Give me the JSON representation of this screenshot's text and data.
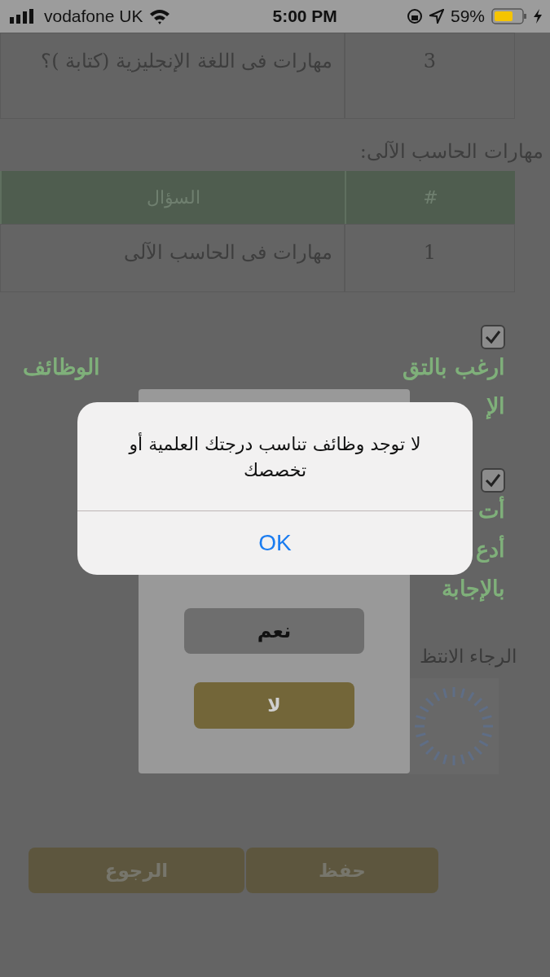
{
  "status_bar": {
    "carrier": "vodafone UK",
    "time": "5:00 PM",
    "battery": "59%"
  },
  "language_table": {
    "rows": [
      {
        "number": "3",
        "question": "مهارات فى اللغة الإنجليزية (كتابة )؟"
      }
    ]
  },
  "computer_section": {
    "heading": "مهارات الحاسب الآلى:",
    "columns": [
      "#",
      "السؤال"
    ],
    "rows": [
      {
        "number": "1",
        "question": "مهارات فى الحاسب الآلى"
      }
    ]
  },
  "agreements": [
    {
      "checked": true,
      "lines": [
        {
          "right": "ارغب بالتق",
          "left": "الوظائف"
        },
        {
          "right": "الإ"
        }
      ]
    },
    {
      "checked": true,
      "lines": [
        {
          "right": "أت"
        },
        {
          "right": "أدع"
        },
        {
          "right": "بالإجابة"
        }
      ]
    }
  ],
  "wait_text": "الرجاء الانتظ",
  "buttons": {
    "back": "الرجوع",
    "save": "حفظ"
  },
  "confirm_popup": {
    "yes": "نعم",
    "no": "لا"
  },
  "alert": {
    "message": "لا توجد وظائف تناسب درجتك العلمية أو تخصصك",
    "button": "OK"
  }
}
